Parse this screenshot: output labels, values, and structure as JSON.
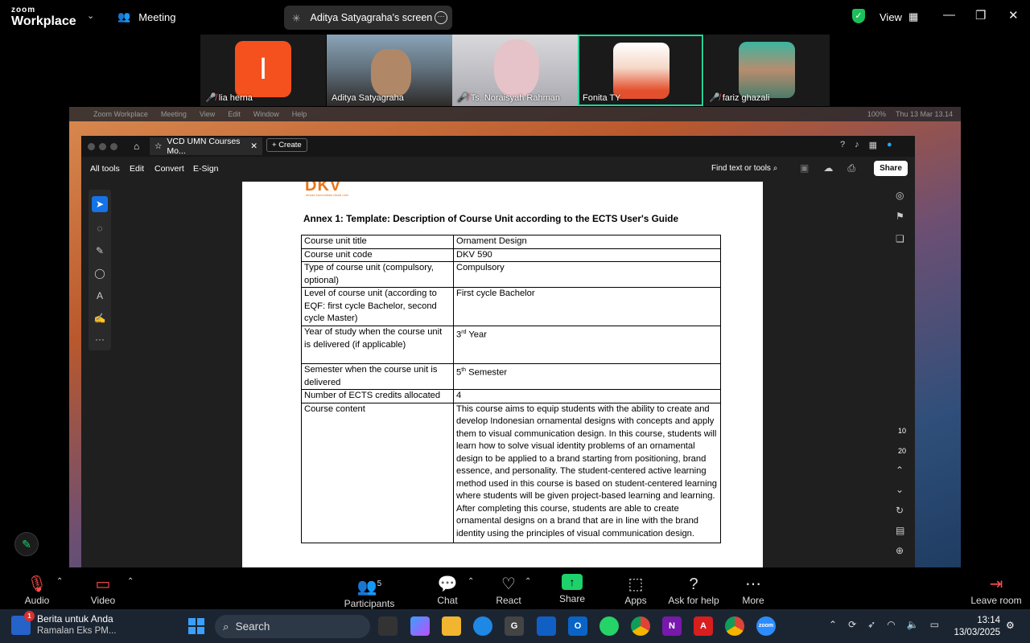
{
  "topbar": {
    "logo_top": "zoom",
    "logo_bottom": "Workplace",
    "meeting_label": "Meeting",
    "screen_share_label": "Aditya Satyagraha's screen",
    "view_label": "View"
  },
  "participants_strip": [
    {
      "name": "lia herna",
      "initial": "I",
      "muted": true
    },
    {
      "name": "Aditya Satyagraha",
      "muted": false
    },
    {
      "name": "Ts. Noraisyah Rahman",
      "muted": true
    },
    {
      "name": "Fonita TY",
      "muted": false,
      "active": true
    },
    {
      "name": "fariz ghazali",
      "muted": true
    }
  ],
  "mac_menubar": {
    "items": [
      "Zoom Workplace",
      "Meeting",
      "View",
      "Edit",
      "Window",
      "Help"
    ],
    "clock": "Thu 13 Mar 13.14",
    "battery": "100%"
  },
  "acrobat": {
    "tab_title": "VCD UMN Courses Mo...",
    "create_label": "Create",
    "menu": [
      "All tools",
      "Edit",
      "Convert",
      "E-Sign"
    ],
    "find_label": "Find text or tools",
    "share_label": "Share",
    "page_current": "10",
    "page_total": "20"
  },
  "document": {
    "logo_text": "DKV",
    "logo_sub": "desain komunikasi visual umn",
    "heading": "Annex 1: Template: Description of Course Unit according to the ECTS User's Guide",
    "rows": [
      {
        "key": "Course unit title",
        "value": "Ornament Design"
      },
      {
        "key": "Course unit code",
        "value": "DKV 590"
      },
      {
        "key": "Type of course unit (compulsory, optional)",
        "value": "Compulsory"
      },
      {
        "key": "Level of course unit (according to EQF: first cycle Bachelor, second cycle Master)",
        "value": "First cycle Bachelor"
      },
      {
        "key": "Year of study when the course unit is delivered (if applicable)",
        "value_num": "3",
        "value_sup": "rd",
        "value_rest": " Year"
      },
      {
        "key": "Semester when the course unit is delivered",
        "value_num": "5",
        "value_sup": "th",
        "value_rest": " Semester"
      },
      {
        "key": "Number of ECTS credits allocated",
        "value": "4"
      },
      {
        "key": "Course content",
        "value": "This course aims to equip students with the ability to create and develop Indonesian ornamental designs with concepts and apply them to visual communication design. In this course, students will learn how to solve visual identity problems of an ornamental design to be applied to a brand starting from positioning, brand essence, and personality. The student-centered active learning method used in this course is based on student-centered learning where students will be given project-based learning and learning. After completing this course, students are able to create ornamental designs on a brand that are in line with the brand identity using the principles of visual communication design."
      }
    ]
  },
  "bottombar": {
    "audio": "Audio",
    "video": "Video",
    "participants": "Participants",
    "participants_count": "5",
    "chat": "Chat",
    "react": "React",
    "share": "Share",
    "apps": "Apps",
    "help": "Ask for help",
    "more": "More",
    "leave": "Leave room"
  },
  "taskbar": {
    "news_title": "Berita untuk Anda",
    "news_sub": "Ramalan Eks PM...",
    "news_badge": "1",
    "search_placeholder": "Search",
    "time": "13:14",
    "date": "13/03/2025"
  }
}
